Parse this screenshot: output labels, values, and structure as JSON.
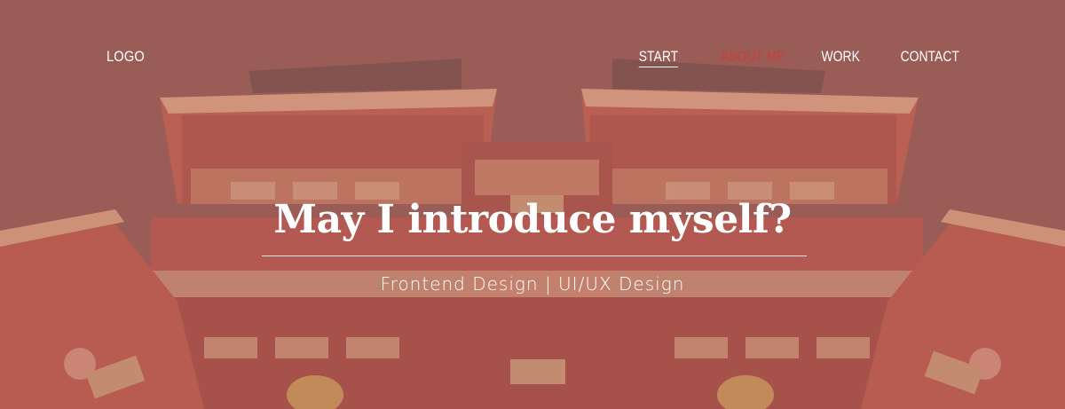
{
  "header": {
    "logo": "LOGO"
  },
  "nav": {
    "items": [
      {
        "label": "START",
        "state": "active"
      },
      {
        "label": "ABOUT ME",
        "state": "highlight"
      },
      {
        "label": "WORK",
        "state": "normal"
      },
      {
        "label": "CONTACT",
        "state": "normal"
      }
    ]
  },
  "hero": {
    "title": "May I introduce myself?",
    "subtitle": "Frontend Design | UI/UX Design",
    "background_icon": "temple-photo",
    "accent_color": "#c8403a",
    "text_color": "#ffffff"
  }
}
